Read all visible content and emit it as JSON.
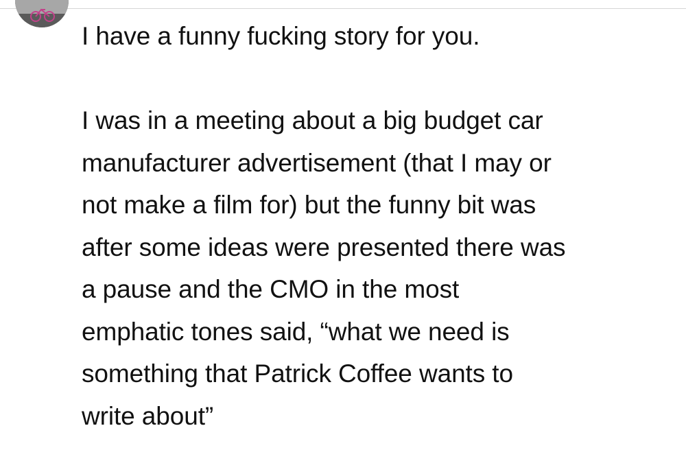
{
  "post": {
    "opening_line": "I have a funny fucking story for you.",
    "paragraph_lines": [
      "I was in a meeting about a big budget car",
      "manufacturer advertisement (that I may or",
      "not make a film for) but the funny bit was",
      "after some ideas were presented there was",
      "a pause and the CMO in the most",
      "emphatic tones said, “what we need is",
      "something that Patrick Coffee wants to",
      "write about”"
    ]
  }
}
